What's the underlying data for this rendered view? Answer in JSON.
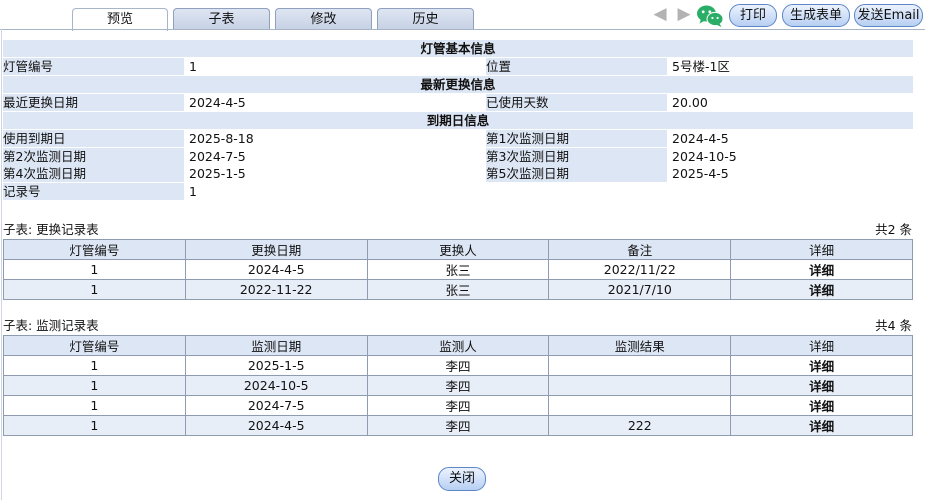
{
  "tabs": [
    {
      "label": "预览"
    },
    {
      "label": "子表"
    },
    {
      "label": "修改"
    },
    {
      "label": "历史"
    }
  ],
  "toolbar": {
    "print_label": "打印",
    "gen_form_label": "生成表单",
    "email_label": "发送Email"
  },
  "info": {
    "basic_header": "灯管基本信息",
    "tube_no_label": "灯管编号",
    "tube_no_value": "1",
    "location_label": "位置",
    "location_value": "5号楼-1区",
    "replace_header": "最新更换信息",
    "last_replace_label": "最近更换日期",
    "last_replace_value": "2024-4-5",
    "days_used_label": "已使用天数",
    "days_used_value": "20.00",
    "expiry_header": "到期日信息",
    "expiry_label": "使用到期日",
    "expiry_value": "2025-8-18",
    "m1_label": "第1次监测日期",
    "m1_value": "2024-4-5",
    "m2_label": "第2次监测日期",
    "m2_value": "2024-7-5",
    "m3_label": "第3次监测日期",
    "m3_value": "2024-10-5",
    "m4_label": "第4次监测日期",
    "m4_value": "2025-1-5",
    "m5_label": "第5次监测日期",
    "m5_value": "2025-4-5",
    "record_no_label": "记录号",
    "record_no_value": "1"
  },
  "replace_table": {
    "title": "子表: 更换记录表",
    "count": "共2 条",
    "headers": [
      "灯管编号",
      "更换日期",
      "更换人",
      "备注",
      "详细"
    ],
    "rows": [
      [
        "1",
        "2024-4-5",
        "张三",
        "2022/11/22",
        "详细"
      ],
      [
        "1",
        "2022-11-22",
        "张三",
        "2021/7/10",
        "详细"
      ]
    ]
  },
  "monitor_table": {
    "title": "子表: 监测记录表",
    "count": "共4 条",
    "headers": [
      "灯管编号",
      "监测日期",
      "监测人",
      "监测结果",
      "详细"
    ],
    "rows": [
      [
        "1",
        "2025-1-5",
        "李四",
        "",
        "详细"
      ],
      [
        "1",
        "2024-10-5",
        "李四",
        "",
        "详细"
      ],
      [
        "1",
        "2024-7-5",
        "李四",
        "",
        "详细"
      ],
      [
        "1",
        "2024-4-5",
        "李四",
        "222",
        "详细"
      ]
    ]
  },
  "footer": {
    "close_label": "关闭"
  },
  "icons": {
    "prev": "left-arrow-icon",
    "next": "right-arrow-icon",
    "wechat": "wechat-icon"
  },
  "colors": {
    "label_bg": "#dde6f4",
    "alt_row_bg": "#e8eef7",
    "button_border": "#5d86c7",
    "wechat_green": "#2aae67"
  }
}
